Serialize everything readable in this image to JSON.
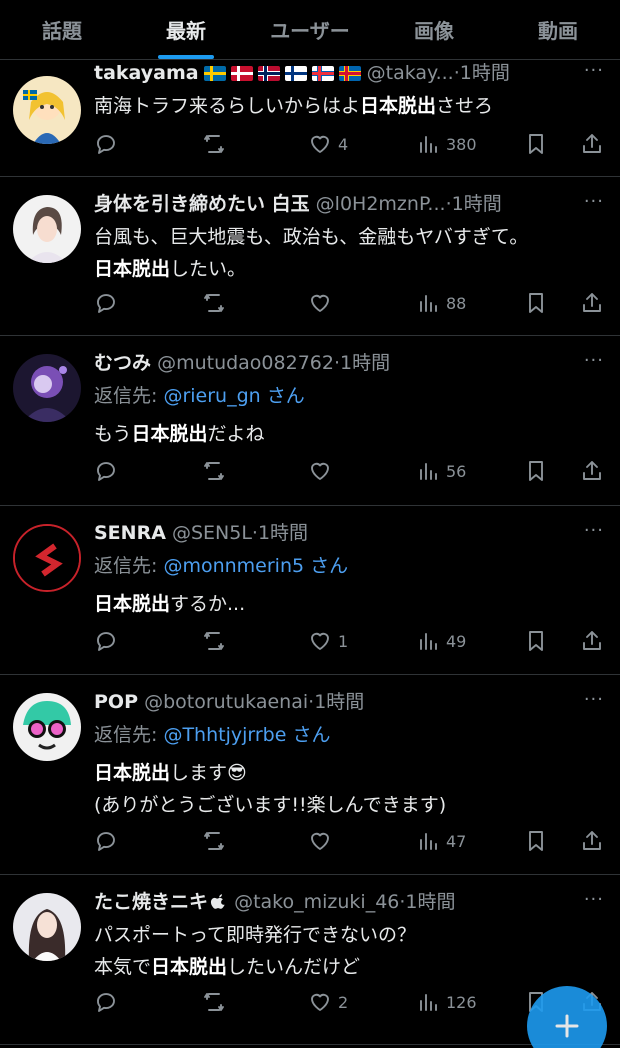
{
  "tabs": [
    "話題",
    "最新",
    "ユーザー",
    "画像",
    "動画"
  ],
  "posts": [
    {
      "name": "takayama",
      "handle": "@takay...",
      "time": "1時間",
      "text_pre": "南海トラフ来るらしいからはよ",
      "highlight": "日本脱出",
      "text_post": "させろ",
      "likes": "4",
      "views": "380"
    },
    {
      "name": "身体を引き締めたい 白玉",
      "handle": "@l0H2mznP...",
      "time": "1時間",
      "text_line1": "台風も、巨大地震も、政治も、金融もヤバすぎて。",
      "highlight": "日本脱出",
      "text_post": "したい。",
      "likes": "",
      "views": "88"
    },
    {
      "name": "むつみ",
      "handle": "@mutudao082762",
      "time": "1時間",
      "reply_label": "返信先:",
      "reply_to": "@rieru_gn",
      "reply_suffix": "さん",
      "text_pre": "もう",
      "highlight": "日本脱出",
      "text_post": "だよね",
      "likes": "",
      "views": "56"
    },
    {
      "name": "SENRA",
      "handle": "@SEN5L",
      "time": "1時間",
      "reply_label": "返信先:",
      "reply_to": "@monnmerin5",
      "reply_suffix": "さん",
      "highlight": "日本脱出",
      "text_post": "するか...",
      "likes": "1",
      "views": "49"
    },
    {
      "name": "POP",
      "handle": "@botorutukaenai",
      "time": "1時間",
      "reply_label": "返信先:",
      "reply_to": "@Thhtjyjrrbe",
      "reply_suffix": "さん",
      "highlight": "日本脱出",
      "text_post": "します😎",
      "text_line2": "(ありがとうございます!!楽しんできます)",
      "likes": "",
      "views": "47"
    },
    {
      "name": "たこ焼きニキ",
      "handle": "@tako_mizuki_46",
      "time": "1時間",
      "text_line1": "パスポートって即時発行できないの？",
      "text_pre": "本気で",
      "highlight": "日本脱出",
      "text_post": "したいんだけど",
      "likes": "2",
      "views": "126"
    }
  ],
  "ui": {
    "more": "···",
    "time_sep": "·"
  },
  "colors": {
    "accent": "#1d9bf0",
    "muted": "#8b9298",
    "mention": "#4d9ff0",
    "divider": "#2f3336"
  },
  "icons": [
    "reply-icon",
    "retweet-icon",
    "like-icon",
    "views-icon",
    "bookmark-icon",
    "share-icon",
    "compose-plus-icon",
    "apple-icon"
  ]
}
